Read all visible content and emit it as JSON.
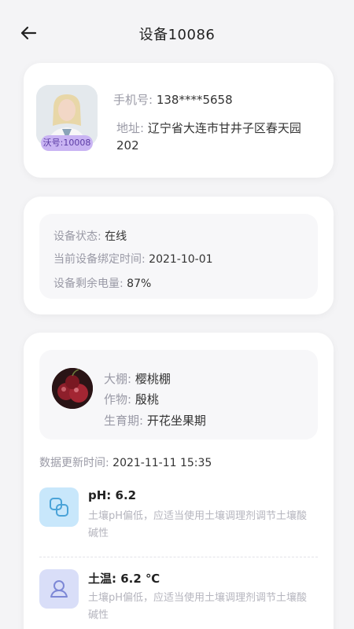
{
  "header": {
    "title": "设备10086",
    "back_icon": "arrow-left-icon"
  },
  "owner": {
    "badge": "沃号:10008",
    "phone_label": "手机号:",
    "phone_value": "138****5658",
    "address_label": "地址:",
    "address_value": "辽宁省大连市甘井子区春天园202"
  },
  "device": {
    "status_label": "设备状态:",
    "status_value": "在线",
    "bind_label": "当前设备绑定时间:",
    "bind_value": "2021-10-01",
    "battery_label": "设备剩余电量:",
    "battery_value": "87%"
  },
  "greenhouse": {
    "shed_label": "大棚:",
    "shed_value": "樱桃棚",
    "crop_label": "作物:",
    "crop_value": "殷桃",
    "stage_label": "生育期:",
    "stage_value": "开花坐果期",
    "update_label": "数据更新时间:",
    "update_value": "2021-11-11 15:35"
  },
  "sensors": [
    {
      "title": "pH: 6.2",
      "desc": "土壤pH偏低，应适当使用土壤调理剂调节土壤酸碱性",
      "icon": "ph-icon",
      "color": "#c8e7fb"
    },
    {
      "title": "土温: 6.2 ℃",
      "desc": "土壤pH偏低，应适当使用土壤调理剂调节土壤酸碱性",
      "icon": "soil-temperature-icon",
      "color": "#d9def8"
    }
  ]
}
